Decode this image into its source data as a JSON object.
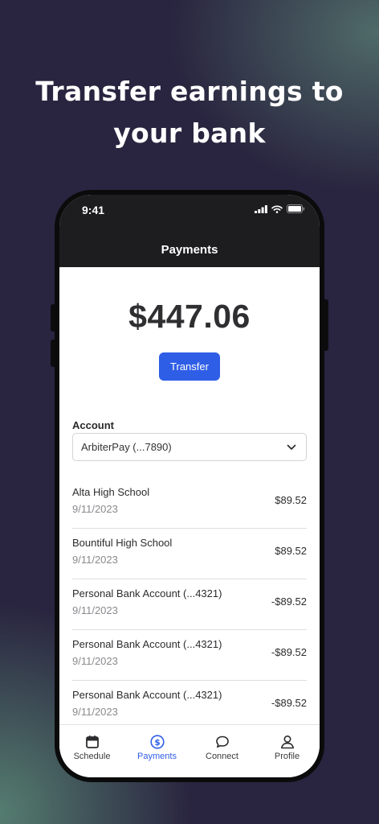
{
  "headline": {
    "line1": "Transfer earnings to",
    "line2": "your bank"
  },
  "status_bar": {
    "time": "9:41"
  },
  "header": {
    "title": "Payments"
  },
  "balance": {
    "amount": "$447.06"
  },
  "actions": {
    "transfer_label": "Transfer"
  },
  "account": {
    "label": "Account",
    "selected": "ArbiterPay (...7890)"
  },
  "transactions": [
    {
      "name": "Alta High School",
      "date": "9/11/2023",
      "amount": "$89.52"
    },
    {
      "name": "Bountiful High School",
      "date": "9/11/2023",
      "amount": "$89.52"
    },
    {
      "name": "Personal Bank Account (...4321)",
      "date": "9/11/2023",
      "amount": "-$89.52"
    },
    {
      "name": "Personal Bank Account (...4321)",
      "date": "9/11/2023",
      "amount": "-$89.52"
    },
    {
      "name": "Personal Bank Account (...4321)",
      "date": "9/11/2023",
      "amount": "-$89.52"
    }
  ],
  "tabs": [
    {
      "label": "Schedule",
      "icon": "calendar-icon",
      "active": false
    },
    {
      "label": "Payments",
      "icon": "dollar-circle-icon",
      "active": true
    },
    {
      "label": "Connect",
      "icon": "chat-bubble-icon",
      "active": false
    },
    {
      "label": "Profile",
      "icon": "person-icon",
      "active": false
    }
  ],
  "colors": {
    "accent": "#2f5ee6",
    "header_bg": "#1d1d1f",
    "page_bg": "#29243f"
  }
}
